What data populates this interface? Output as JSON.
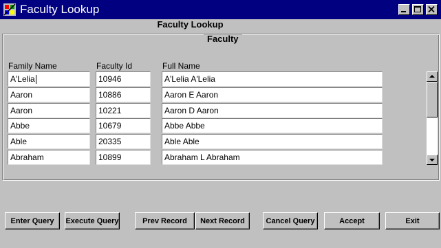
{
  "window": {
    "title": "Faculty Lookup"
  },
  "form": {
    "title": "Faculty Lookup",
    "group_label": "Faculty"
  },
  "columns": {
    "family_name": "Family Name",
    "faculty_id": "Faculty Id",
    "full_name": "Full Name"
  },
  "rows": [
    {
      "family_name": "A'Lelia",
      "faculty_id": "10946",
      "full_name": "A'Lelia  A'Lelia"
    },
    {
      "family_name": "Aaron",
      "faculty_id": "10886",
      "full_name": "Aaron E Aaron"
    },
    {
      "family_name": "Aaron",
      "faculty_id": "10221",
      "full_name": "Aaron D Aaron"
    },
    {
      "family_name": "Abbe",
      "faculty_id": "10679",
      "full_name": "Abbe  Abbe"
    },
    {
      "family_name": "Able",
      "faculty_id": "20335",
      "full_name": "Able  Able"
    },
    {
      "family_name": "Abraham",
      "faculty_id": "10899",
      "full_name": "Abraham L Abraham"
    }
  ],
  "buttons": {
    "enter_query": "Enter Query",
    "execute_query": "Execute Query",
    "prev_record": "Prev Record",
    "next_record": "Next Record",
    "cancel_query": "Cancel Query",
    "accept": "Accept",
    "exit": "Exit"
  },
  "colors": {
    "titlebar": "#000080",
    "face": "#c0c0c0",
    "field": "#ffffff"
  },
  "icons": {
    "app": "oracle-forms-app-icon"
  }
}
